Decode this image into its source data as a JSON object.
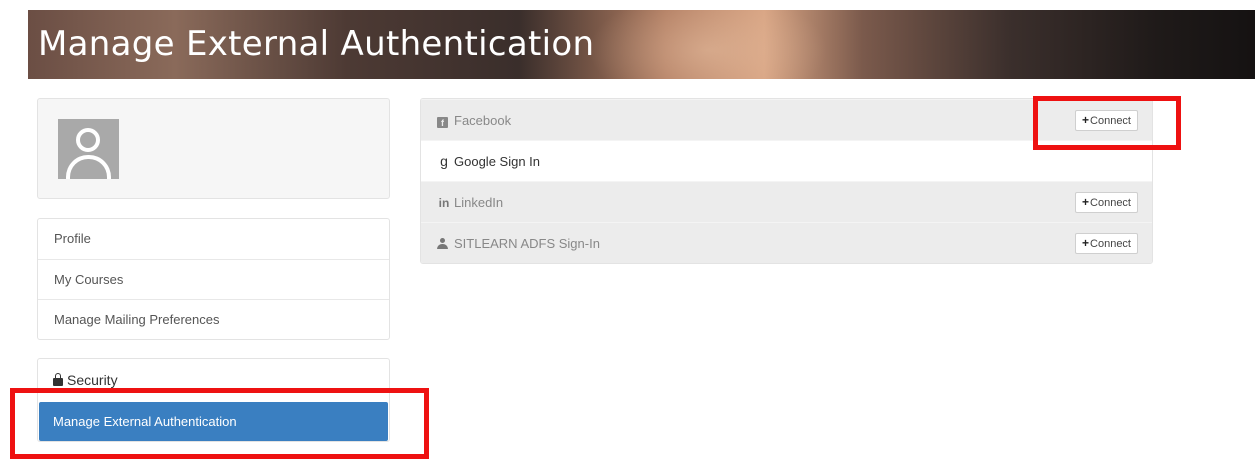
{
  "page_title": "Manage External Authentication",
  "sidebar": {
    "avatar": "default-user-avatar",
    "items": [
      {
        "label": "Profile"
      },
      {
        "label": "My Courses"
      },
      {
        "label": "Manage Mailing Preferences"
      }
    ],
    "security": {
      "heading": "Security",
      "icon": "lock-icon",
      "active_item": "Manage External Authentication"
    }
  },
  "providers": [
    {
      "name": "Facebook",
      "icon": "facebook-icon",
      "action": "Connect"
    },
    {
      "name": "Google Sign In",
      "icon": "google-icon"
    },
    {
      "name": "LinkedIn",
      "icon": "linkedin-icon",
      "action": "Connect"
    },
    {
      "name": "SITLEARN ADFS Sign-In",
      "icon": "user-icon",
      "action": "Connect"
    }
  ],
  "highlight_color": "#ee1111",
  "accent_color": "#3a7fc1"
}
